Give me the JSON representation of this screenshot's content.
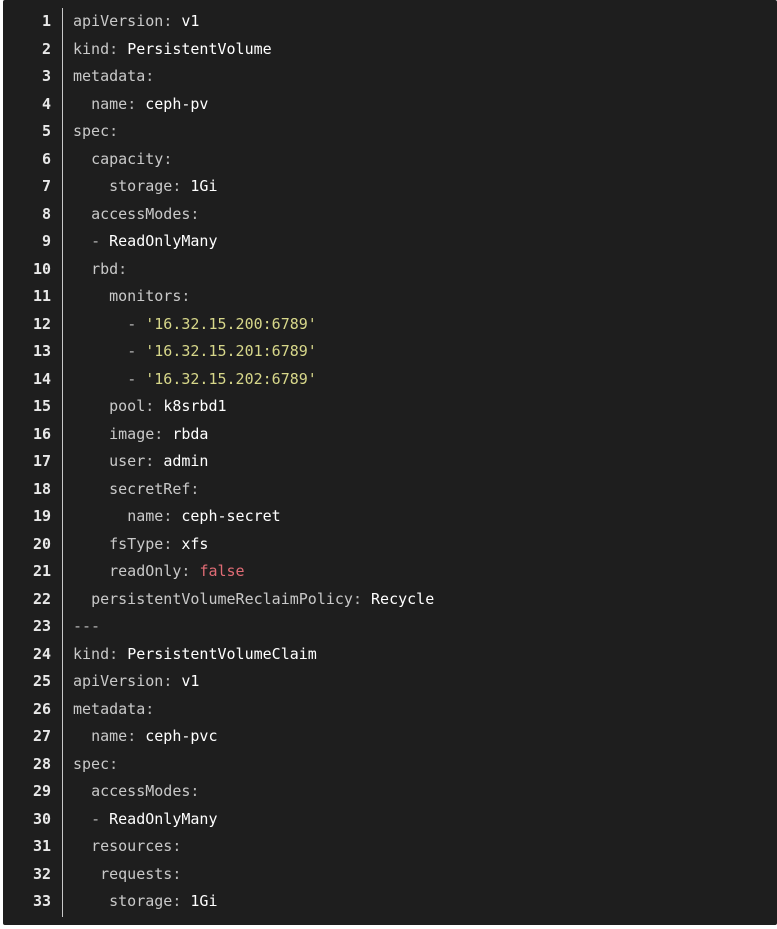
{
  "editor": {
    "language": "yaml",
    "colors": {
      "background": "#1e1e1e",
      "line_number": "#e8e8e8",
      "key": "#c9c9c9",
      "value": "#ffffff",
      "string": "#d7d78a",
      "boolean": "#e06c75"
    },
    "lines": [
      {
        "n": "1",
        "indent": "",
        "key": "apiVersion",
        "sep": ": ",
        "value": "v1",
        "vtype": "plain"
      },
      {
        "n": "2",
        "indent": "",
        "key": "kind",
        "sep": ": ",
        "value": "PersistentVolume",
        "vtype": "plain"
      },
      {
        "n": "3",
        "indent": "",
        "key": "metadata",
        "sep": ":",
        "value": "",
        "vtype": "plain"
      },
      {
        "n": "4",
        "indent": "  ",
        "key": "name",
        "sep": ": ",
        "value": "ceph-pv",
        "vtype": "plain"
      },
      {
        "n": "5",
        "indent": "",
        "key": "spec",
        "sep": ":",
        "value": "",
        "vtype": "plain"
      },
      {
        "n": "6",
        "indent": "  ",
        "key": "capacity",
        "sep": ":",
        "value": "",
        "vtype": "plain"
      },
      {
        "n": "7",
        "indent": "    ",
        "key": "storage",
        "sep": ": ",
        "value": "1Gi",
        "vtype": "plain"
      },
      {
        "n": "8",
        "indent": "  ",
        "key": "accessModes",
        "sep": ":",
        "value": "",
        "vtype": "plain"
      },
      {
        "n": "9",
        "indent": "  ",
        "key": "",
        "sep": "- ",
        "value": "ReadOnlyMany",
        "vtype": "plain"
      },
      {
        "n": "10",
        "indent": "  ",
        "key": "rbd",
        "sep": ":",
        "value": "",
        "vtype": "plain"
      },
      {
        "n": "11",
        "indent": "    ",
        "key": "monitors",
        "sep": ":",
        "value": "",
        "vtype": "plain"
      },
      {
        "n": "12",
        "indent": "      ",
        "key": "",
        "sep": "- ",
        "value": "'16.32.15.200:6789'",
        "vtype": "string"
      },
      {
        "n": "13",
        "indent": "      ",
        "key": "",
        "sep": "- ",
        "value": "'16.32.15.201:6789'",
        "vtype": "string"
      },
      {
        "n": "14",
        "indent": "      ",
        "key": "",
        "sep": "- ",
        "value": "'16.32.15.202:6789'",
        "vtype": "string"
      },
      {
        "n": "15",
        "indent": "    ",
        "key": "pool",
        "sep": ": ",
        "value": "k8srbd1",
        "vtype": "plain"
      },
      {
        "n": "16",
        "indent": "    ",
        "key": "image",
        "sep": ": ",
        "value": "rbda",
        "vtype": "plain"
      },
      {
        "n": "17",
        "indent": "    ",
        "key": "user",
        "sep": ": ",
        "value": "admin",
        "vtype": "plain"
      },
      {
        "n": "18",
        "indent": "    ",
        "key": "secretRef",
        "sep": ":",
        "value": "",
        "vtype": "plain"
      },
      {
        "n": "19",
        "indent": "      ",
        "key": "name",
        "sep": ": ",
        "value": "ceph-secret",
        "vtype": "plain"
      },
      {
        "n": "20",
        "indent": "    ",
        "key": "fsType",
        "sep": ": ",
        "value": "xfs",
        "vtype": "plain"
      },
      {
        "n": "21",
        "indent": "    ",
        "key": "readOnly",
        "sep": ": ",
        "value": "false",
        "vtype": "boolean"
      },
      {
        "n": "22",
        "indent": "  ",
        "key": "persistentVolumeReclaimPolicy",
        "sep": ": ",
        "value": "Recycle",
        "vtype": "plain"
      },
      {
        "n": "23",
        "indent": "",
        "key": "",
        "sep": "---",
        "value": "",
        "vtype": "plain"
      },
      {
        "n": "24",
        "indent": "",
        "key": "kind",
        "sep": ": ",
        "value": "PersistentVolumeClaim",
        "vtype": "plain"
      },
      {
        "n": "25",
        "indent": "",
        "key": "apiVersion",
        "sep": ": ",
        "value": "v1",
        "vtype": "plain"
      },
      {
        "n": "26",
        "indent": "",
        "key": "metadata",
        "sep": ":",
        "value": "",
        "vtype": "plain"
      },
      {
        "n": "27",
        "indent": "  ",
        "key": "name",
        "sep": ": ",
        "value": "ceph-pvc",
        "vtype": "plain"
      },
      {
        "n": "28",
        "indent": "",
        "key": "spec",
        "sep": ":",
        "value": "",
        "vtype": "plain"
      },
      {
        "n": "29",
        "indent": "  ",
        "key": "accessModes",
        "sep": ":",
        "value": "",
        "vtype": "plain"
      },
      {
        "n": "30",
        "indent": "  ",
        "key": "",
        "sep": "- ",
        "value": "ReadOnlyMany",
        "vtype": "plain"
      },
      {
        "n": "31",
        "indent": "  ",
        "key": "resources",
        "sep": ":",
        "value": "",
        "vtype": "plain"
      },
      {
        "n": "32",
        "indent": "   ",
        "key": "requests",
        "sep": ":",
        "value": "",
        "vtype": "plain"
      },
      {
        "n": "33",
        "indent": "    ",
        "key": "storage",
        "sep": ": ",
        "value": "1Gi",
        "vtype": "plain"
      }
    ]
  }
}
